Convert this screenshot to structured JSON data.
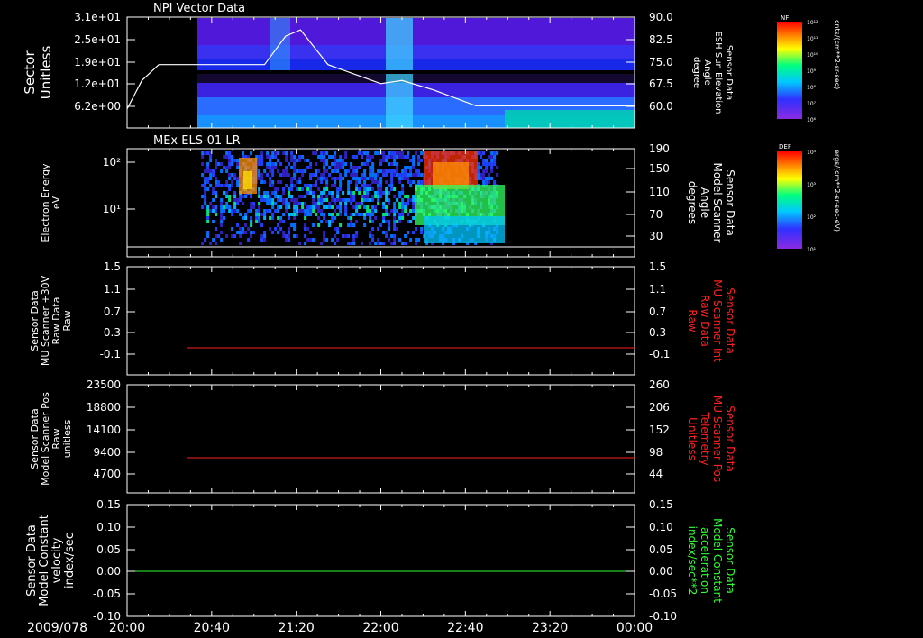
{
  "colors": {
    "background": "#000000",
    "axis": "#ffffff",
    "red_trace": "#ff2020",
    "green_trace": "#30ff30",
    "white_trace": "#ffffff"
  },
  "panels": [
    {
      "id": "npi",
      "title": "NPI Vector Data",
      "ylabel_lines": [
        "Sector",
        "Unitless"
      ],
      "yticks": [
        "3.1e+01",
        "2.5e+01",
        "1.9e+01",
        "1.2e+01",
        "6.2e+00"
      ],
      "ylabel_right_lines": [
        "Sensor Data",
        "ESH Sun Elevation",
        "Angle",
        "degree"
      ],
      "yticks_right": [
        "90.0",
        "82.5",
        "75.0",
        "67.5",
        "60.0"
      ],
      "right_label_color": "#ffffff"
    },
    {
      "id": "els",
      "title": "MEx ELS-01 LR",
      "ylabel_lines": [
        "Electron Energy",
        "eV"
      ],
      "yticks": [
        "10²",
        "10¹"
      ],
      "ylabel_right_lines": [
        "Sensor Data",
        "Model Scanner",
        "Angle",
        "degrees"
      ],
      "yticks_right": [
        "190",
        "150",
        "110",
        "70",
        "30"
      ],
      "right_label_color": "#ffffff"
    },
    {
      "id": "mu_raw",
      "title": "",
      "ylabel_lines": [
        "Sensor Data",
        "MU Scanner +30V",
        "Raw Data",
        "Raw"
      ],
      "yticks": [
        "1.5",
        "1.1",
        "0.7",
        "0.3",
        "-0.1"
      ],
      "ylabel_right_lines": [
        "Sensor Data",
        "MU Scanner Int",
        "Raw Data",
        "Raw"
      ],
      "yticks_right": [
        "1.5",
        "1.1",
        "0.7",
        "0.3",
        "-0.1"
      ],
      "right_label_color": "#ff2020"
    },
    {
      "id": "scanner_pos",
      "title": "",
      "ylabel_lines": [
        "Sensor Data",
        "Model Scanner Pos",
        "Raw",
        "unitless"
      ],
      "yticks": [
        "23500",
        "18800",
        "14100",
        "9400",
        "4700"
      ],
      "ylabel_right_lines": [
        "Sensor Data",
        "MU Scanner Pos",
        "Telemetry",
        "Unitless"
      ],
      "yticks_right": [
        "260",
        "206",
        "152",
        "98",
        "44"
      ],
      "right_label_color": "#ff2020"
    },
    {
      "id": "const",
      "title": "",
      "ylabel_lines": [
        "Sensor Data",
        "Model Constant",
        "velocity",
        "index/sec"
      ],
      "yticks": [
        "0.15",
        "0.10",
        "0.05",
        "0.00",
        "-0.05",
        "-0.10"
      ],
      "ylabel_right_lines": [
        "Sensor Data",
        "Model Constant",
        "acceleration",
        "index/sec**2"
      ],
      "yticks_right": [
        "0.15",
        "0.10",
        "0.05",
        "0.00",
        "-0.05",
        "-0.10"
      ],
      "right_label_color": "#30ff30"
    }
  ],
  "xaxis": {
    "date_label": "2009/078",
    "ticks": [
      "20:00",
      "20:40",
      "21:20",
      "22:00",
      "22:40",
      "23:20",
      "00:00"
    ]
  },
  "colorbars": [
    {
      "label": "NF",
      "units": "cnts/(cm**2-sr-sec)",
      "ticks": [
        "10¹²",
        "10¹¹",
        "10¹⁰",
        "10⁹",
        "10⁸",
        "10⁷",
        "10⁶"
      ]
    },
    {
      "label": "DEF",
      "units": "ergs/(cm**2-sr-sec-eV)",
      "ticks": [
        "10⁴",
        "10³",
        "10²",
        "10¹"
      ]
    }
  ],
  "chart_data": [
    {
      "type": "heatmap",
      "title": "NPI Vector Data",
      "ylabel": "Sector Unitless",
      "yticks": [
        31,
        25,
        19,
        12,
        6.2
      ],
      "xrange": [
        "20:00",
        "00:00"
      ],
      "data_start": "20:35",
      "overlay_series": {
        "name": "Sensor Data ESH Sun Elevation Angle",
        "axis": "right",
        "ylim": [
          55,
          90
        ],
        "x": [
          "20:00",
          "20:07",
          "20:15",
          "20:40",
          "21:05",
          "21:15",
          "21:22",
          "21:35",
          "22:00",
          "22:10",
          "22:25",
          "22:45",
          "00:00"
        ],
        "y": [
          61,
          70,
          75,
          75,
          75,
          84,
          86,
          75,
          69,
          70,
          67,
          62,
          62
        ]
      }
    },
    {
      "type": "heatmap",
      "title": "MEx ELS-01 LR",
      "ylabel": "Electron Energy eV",
      "yscale": "log",
      "xrange": [
        "20:00",
        "00:00"
      ],
      "data_start": "20:35",
      "data_end": "22:55",
      "overlay_series": {
        "name": "Sensor Data Model Scanner Angle",
        "axis": "right",
        "ylim": [
          10,
          190
        ],
        "x": [
          "20:00",
          "00:00"
        ],
        "y": [
          13,
          13
        ]
      }
    },
    {
      "type": "line",
      "series": [
        {
          "name": "Sensor Data MU Scanner Int Raw Data",
          "x": [
            "20:35",
            "00:00"
          ],
          "y": [
            -0.1,
            -0.1
          ]
        }
      ],
      "ylim": [
        -0.3,
        1.5
      ]
    },
    {
      "type": "line",
      "series": [
        {
          "name": "Sensor Data MU Scanner Pos Telemetry",
          "x": [
            "20:35",
            "00:00"
          ],
          "y": [
            90,
            90
          ]
        }
      ],
      "ylim_right": [
        0,
        260
      ]
    },
    {
      "type": "line",
      "series": [
        {
          "name": "Sensor Data Model Constant acceleration",
          "x": [
            "20:00",
            "00:00"
          ],
          "y": [
            0,
            0
          ]
        }
      ],
      "ylim": [
        -0.1,
        0.15
      ]
    }
  ]
}
